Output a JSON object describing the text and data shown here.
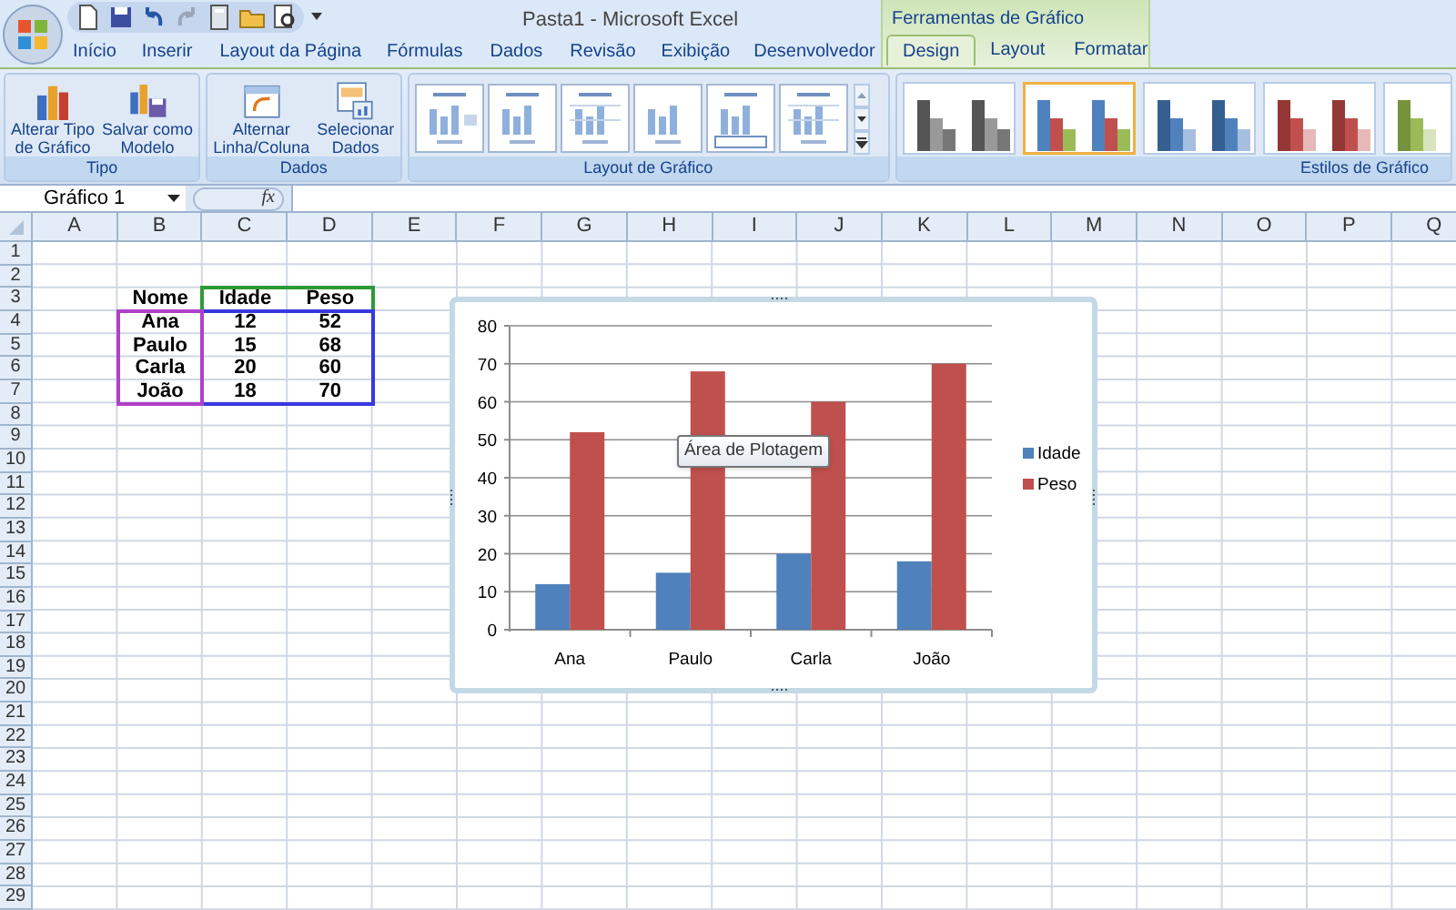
{
  "window": {
    "title": "Pasta1 - Microsoft Excel"
  },
  "quick_access": [
    {
      "kind": "new"
    },
    {
      "kind": "save"
    },
    {
      "kind": "undo"
    },
    {
      "kind": "redo"
    },
    {
      "kind": "calculator"
    },
    {
      "kind": "open"
    },
    {
      "kind": "preview"
    }
  ],
  "tabs": [
    {
      "label": "Início",
      "selected": false
    },
    {
      "label": "Inserir",
      "selected": false
    },
    {
      "label": "Layout da Página",
      "selected": false
    },
    {
      "label": "Fórmulas",
      "selected": false
    },
    {
      "label": "Dados",
      "selected": false
    },
    {
      "label": "Revisão",
      "selected": false
    },
    {
      "label": "Exibição",
      "selected": false
    },
    {
      "label": "Desenvolvedor",
      "selected": false
    }
  ],
  "contextual_group": {
    "label": "Ferramentas de Gráfico",
    "tabs": [
      {
        "label": "Design",
        "selected": true
      },
      {
        "label": "Layout",
        "selected": false
      },
      {
        "label": "Formatar",
        "selected": false
      }
    ]
  },
  "ribbon_groups": [
    {
      "label": "Tipo",
      "buttons": [
        {
          "kind": "chart-type",
          "lines": [
            "Alterar Tipo",
            "de Gráfico"
          ]
        },
        {
          "kind": "save-template",
          "lines": [
            "Salvar como",
            "Modelo"
          ]
        }
      ]
    },
    {
      "label": "Dados",
      "buttons": [
        {
          "kind": "switch",
          "lines": [
            "Alternar",
            "Linha/Coluna"
          ]
        },
        {
          "kind": "select-data",
          "lines": [
            "Selecionar",
            "Dados"
          ]
        }
      ]
    },
    {
      "label": "Layout de Gráfico",
      "layouts": [
        {
          "kind": "legend"
        },
        {
          "kind": "titled"
        },
        {
          "kind": "banded"
        },
        {
          "kind": "plain"
        },
        {
          "kind": "table"
        },
        {
          "kind": "grid"
        }
      ]
    },
    {
      "label": "Estilos de Gráfico",
      "styles": [
        {
          "kind": "gray",
          "selected": false
        },
        {
          "kind": "multi",
          "selected": true
        },
        {
          "kind": "blue",
          "selected": false
        },
        {
          "kind": "red",
          "selected": false
        },
        {
          "kind": "green",
          "selected": false
        }
      ]
    }
  ],
  "name_box": {
    "value": "Gráfico 1"
  },
  "formula_bar": {
    "fx_label": "fx"
  },
  "columns": [
    "A",
    "B",
    "C",
    "D",
    "E",
    "F",
    "G",
    "H",
    "I",
    "J",
    "K",
    "L",
    "M",
    "N",
    "O",
    "P",
    "Q"
  ],
  "rows": [
    "1",
    "2",
    "3",
    "4",
    "5",
    "6",
    "7",
    "8",
    "9",
    "10",
    "11",
    "12",
    "13",
    "14",
    "15",
    "16",
    "17",
    "18",
    "19",
    "20",
    "21",
    "22",
    "23",
    "24",
    "25",
    "26",
    "27",
    "28",
    "29"
  ],
  "sheet_table": {
    "header": [
      "Nome",
      "Idade",
      "Peso"
    ],
    "rows": [
      [
        "Ana",
        "12",
        "52"
      ],
      [
        "Paulo",
        "15",
        "68"
      ],
      [
        "Carla",
        "20",
        "60"
      ],
      [
        "João",
        "18",
        "70"
      ]
    ]
  },
  "chart": {
    "tooltip": "Área de Plotagem",
    "chart_data": {
      "type": "bar",
      "categories": [
        "Ana",
        "Paulo",
        "Carla",
        "João"
      ],
      "series": [
        {
          "name": "Idade",
          "color": "#4f81bd",
          "values": [
            12,
            15,
            20,
            18
          ]
        },
        {
          "name": "Peso",
          "color": "#c0504d",
          "values": [
            52,
            68,
            60,
            70
          ]
        }
      ],
      "grid": true,
      "legend": "right",
      "ylim": [
        0,
        80
      ],
      "yticks": [
        0,
        10,
        20,
        30,
        40,
        50,
        60,
        70,
        80
      ]
    }
  }
}
